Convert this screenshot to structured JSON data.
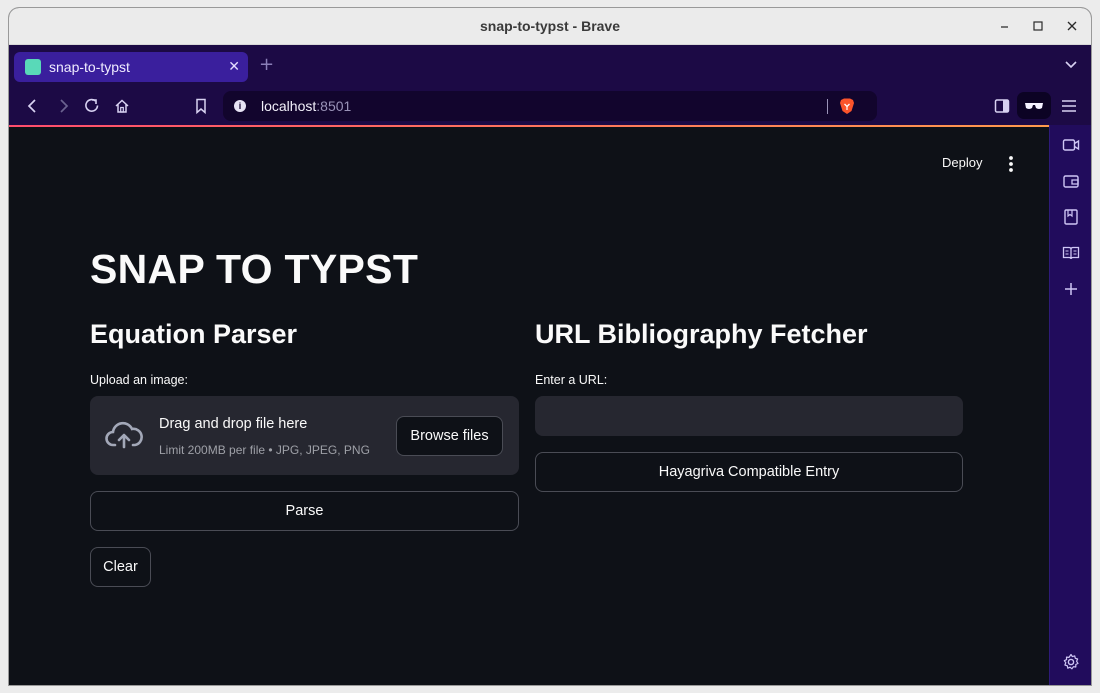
{
  "window": {
    "title": "snap-to-typst - Brave"
  },
  "tabs": [
    {
      "label": "snap-to-typst",
      "favicon": "typst-favicon"
    }
  ],
  "address_bar": {
    "host": "localhost",
    "port": ":8501"
  },
  "app": {
    "deploy_label": "Deploy",
    "title": "SNAP TO TYPST",
    "left": {
      "heading": "Equation Parser",
      "upload_label": "Upload an image:",
      "dropzone_text": "Drag and drop file here",
      "dropzone_limit": "Limit 200MB per file • JPG, JPEG, PNG",
      "browse_label": "Browse files",
      "parse_label": "Parse",
      "clear_label": "Clear"
    },
    "right": {
      "heading": "URL Bibliography Fetcher",
      "url_label": "Enter a URL:",
      "url_value": "",
      "entry_button_label": "Hayagriva Compatible Entry"
    }
  },
  "colors": {
    "page_bg": "#0e1117",
    "widget_bg": "#262730",
    "tab_strip": "#1c0a45",
    "active_tab": "#3a1f9d",
    "sidebar": "#210c5c",
    "accent_line_start": "#ff4d6d",
    "accent_line_end": "#ff9a4d"
  }
}
